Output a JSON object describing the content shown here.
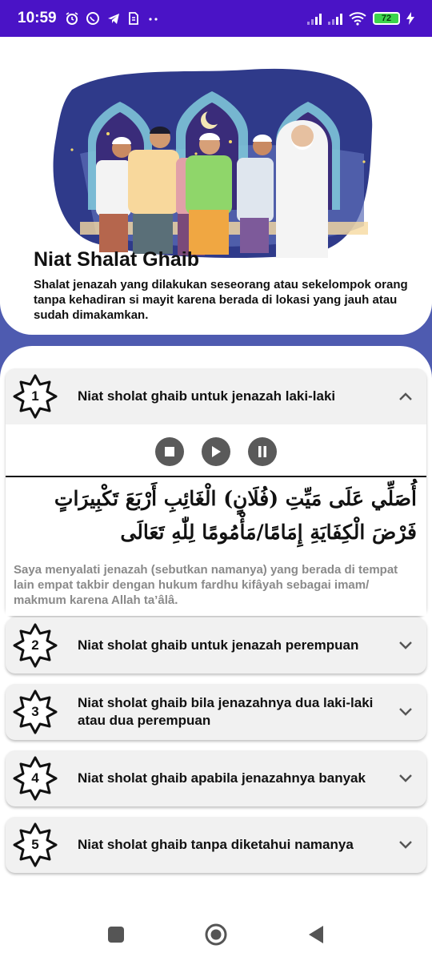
{
  "status_bar": {
    "time": "10:59",
    "battery": "72"
  },
  "header": {
    "title": "Niat Shalat Ghaib",
    "description": "Shalat jenazah yang dilakukan seseorang atau sekelompok orang tanpa kehadiran si mayit karena berada di lokasi yang jauh atau sudah dimakamkan."
  },
  "items": [
    {
      "number": "1",
      "title": "Niat sholat ghaib untuk jenazah laki-laki",
      "expanded": true,
      "arabic": "أُصَلِّي عَلَى مَيِّتِ (فُلَانٍ) الْغَائِبِ أَرْبَعَ تَكْبِيرَاتٍ فَرْضَ الْكِفَايَةِ إِمَامًا/مَأْمُومًا لِلّٰهِ تَعَالَى",
      "translation": "Saya menyalati jenazah (sebutkan namanya) yang berada di tempat lain empat takbir dengan hukum fardhu kifâyah sebagai imam/ makmum karena Allah ta’âlâ."
    },
    {
      "number": "2",
      "title": "Niat sholat ghaib untuk jenazah perempuan",
      "expanded": false
    },
    {
      "number": "3",
      "title": "Niat sholat ghaib bila jenazahnya dua laki-laki atau dua perempuan",
      "expanded": false
    },
    {
      "number": "4",
      "title": "Niat sholat ghaib apabila jenazahnya banyak",
      "expanded": false
    },
    {
      "number": "5",
      "title": "Niat sholat ghaib tanpa diketahui namanya",
      "expanded": false
    }
  ],
  "icons": {
    "status_left": [
      "alarm-icon",
      "whatsapp-icon",
      "telegram-icon",
      "sim-icon",
      "more-dots-icon"
    ],
    "status_right": [
      "signal-icon",
      "signal-icon",
      "wifi-icon",
      "battery-icon",
      "charging-icon"
    ],
    "player": [
      "stop-icon",
      "play-icon",
      "pause-icon"
    ],
    "nav": [
      "recents-icon",
      "home-icon",
      "back-icon"
    ]
  },
  "colors": {
    "status_bar": "#4a13c6",
    "accent_band": "#4e5bb0",
    "card": "#f1f1f1",
    "control": "#5a5a5a"
  }
}
